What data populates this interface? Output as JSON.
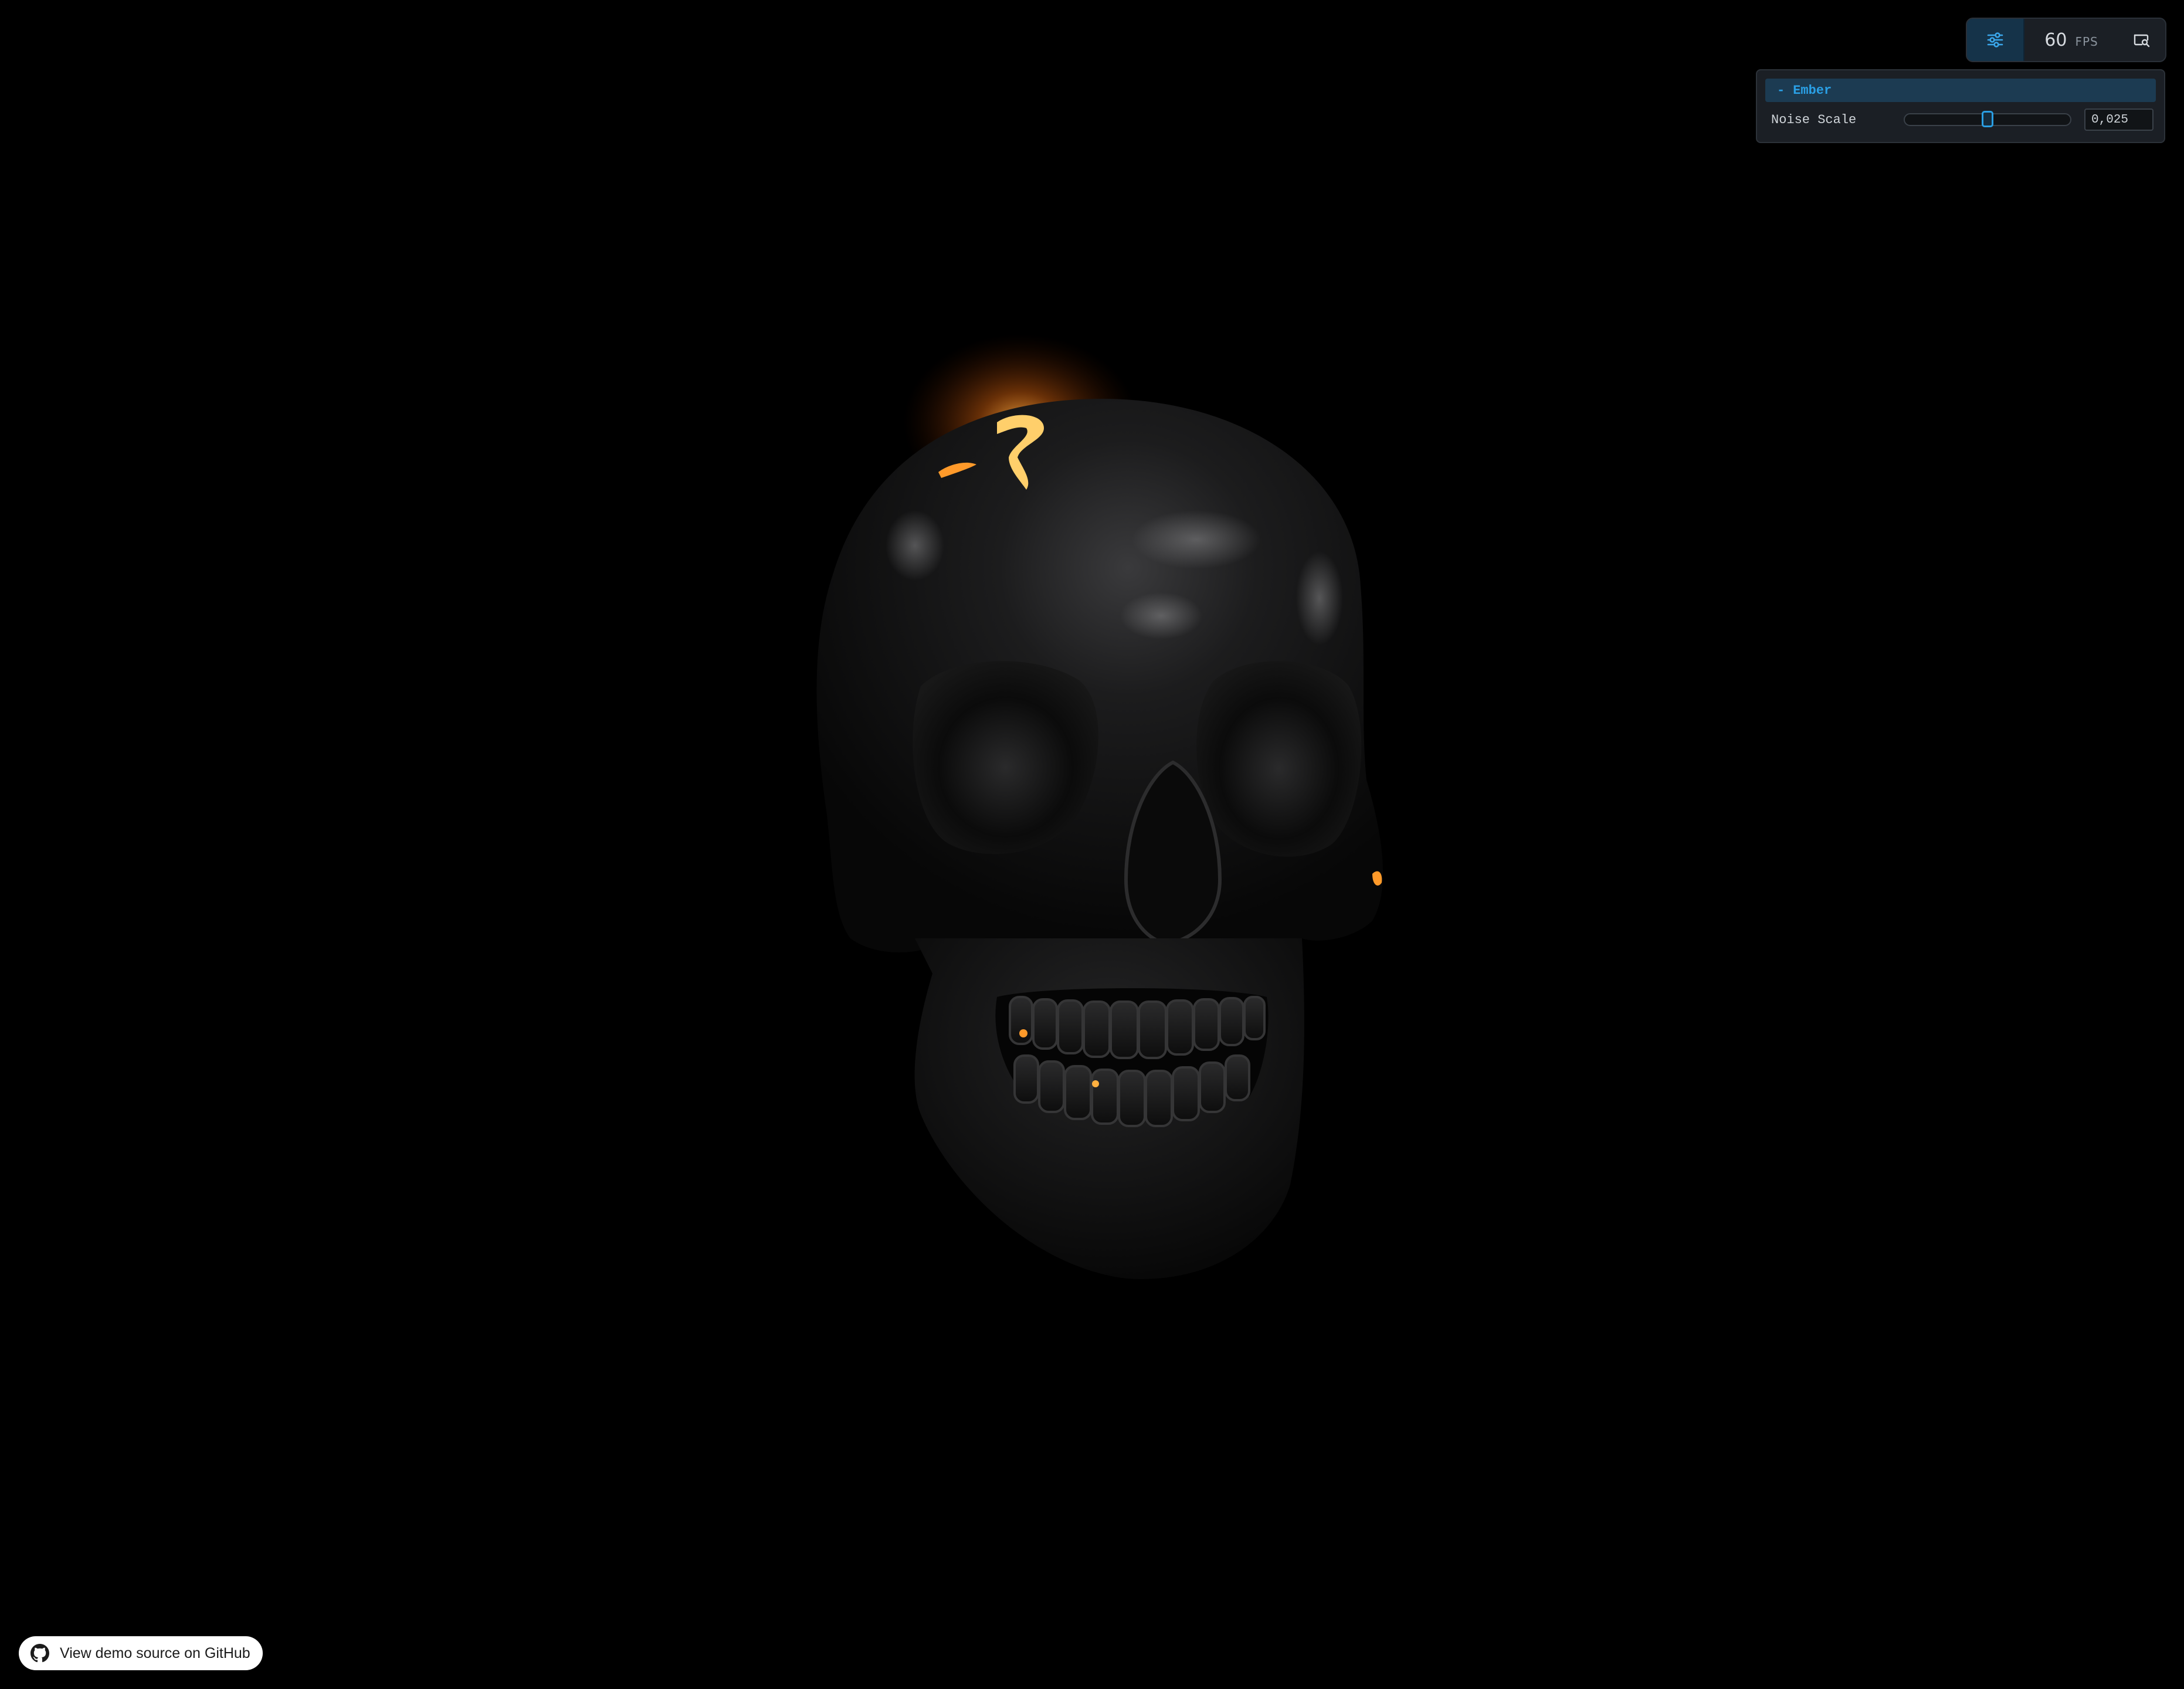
{
  "toolbar": {
    "fps_value": "60",
    "fps_unit": "FPS",
    "controls_icon": "sliders-icon",
    "screenshot_icon": "screenshot-icon"
  },
  "panel": {
    "folder": {
      "toggle": "-",
      "title": "Ember"
    },
    "controls": [
      {
        "label": "Noise Scale",
        "value": "0,025",
        "slider_fraction": 0.5
      }
    ]
  },
  "footer": {
    "github_icon": "github-icon",
    "link_label": "View demo source on GitHub"
  },
  "colors": {
    "background": "#000000",
    "accent": "#2aa0e6",
    "ember": "#ff9a2a"
  }
}
